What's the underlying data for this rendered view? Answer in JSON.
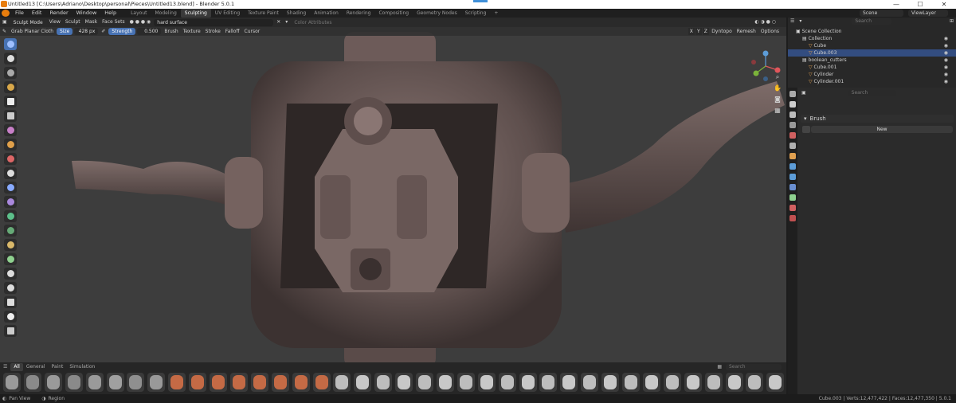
{
  "os_title": "Untitled13 [C:\\Users\\Adriano\\Desktop\\personal\\Pieces\\Untitled13.blend] - Blender 5.0.1",
  "window_controls": {
    "minimize": "—",
    "maximize": "☐",
    "close": "✕"
  },
  "menus": [
    "File",
    "Edit",
    "Render",
    "Window",
    "Help"
  ],
  "workspaces": [
    "Layout",
    "Modeling",
    "Sculpting",
    "UV Editing",
    "Texture Paint",
    "Shading",
    "Animation",
    "Rendering",
    "Compositing",
    "Geometry Nodes",
    "Scripting"
  ],
  "active_workspace": "Sculpting",
  "add_workspace": "+",
  "scene": {
    "label": "Scene",
    "view_layer": "ViewLayer"
  },
  "viewport_header": {
    "mode": "Sculpt Mode",
    "menus": [
      "View",
      "Sculpt",
      "Mask",
      "Face Sets"
    ],
    "search_value": "hard surface",
    "color_attributes": "Color Attributes",
    "symmetry": [
      "X",
      "Y",
      "Z"
    ],
    "dyntopo": "Dyntopo",
    "remesh": "Remesh",
    "options": "Options"
  },
  "tool_settings": {
    "brush_name": "Grab Planar Cloth",
    "size_label": "Size",
    "size_value": "428 px",
    "strength_label": "Strength",
    "strength_value": "0.500",
    "menus": [
      "Brush",
      "Texture",
      "Stroke",
      "Falloff",
      "Cursor"
    ]
  },
  "asset_shelf": {
    "tabs": [
      "All",
      "General",
      "Paint",
      "Simulation"
    ],
    "active_tab": "All",
    "search_placeholder": "Search"
  },
  "status_bar": {
    "left": [
      "Pan View",
      "Region"
    ],
    "right": "Cube.003 | Verts:12,477,422 | Faces:12,477,350 | 5.0.1"
  },
  "outliner": {
    "search_placeholder": "Search",
    "rows": [
      {
        "label": "Scene Collection",
        "indent": 0
      },
      {
        "label": "Collection",
        "indent": 1
      },
      {
        "label": "Cube",
        "indent": 2
      },
      {
        "label": "Cube.003",
        "indent": 2,
        "selected": true
      },
      {
        "label": "boolean_cutters",
        "indent": 1
      },
      {
        "label": "Cube.001",
        "indent": 2
      },
      {
        "label": "Cylinder",
        "indent": 2
      },
      {
        "label": "Cylinder.001",
        "indent": 2
      }
    ]
  },
  "properties": {
    "search_placeholder": "Search",
    "panel_title": "Brush",
    "new_button": "New"
  },
  "colors": {
    "accent": "#4772b3",
    "selected": "#334d80",
    "viewport_bg": "#3d3d3d",
    "model": "#6f5d5b"
  }
}
